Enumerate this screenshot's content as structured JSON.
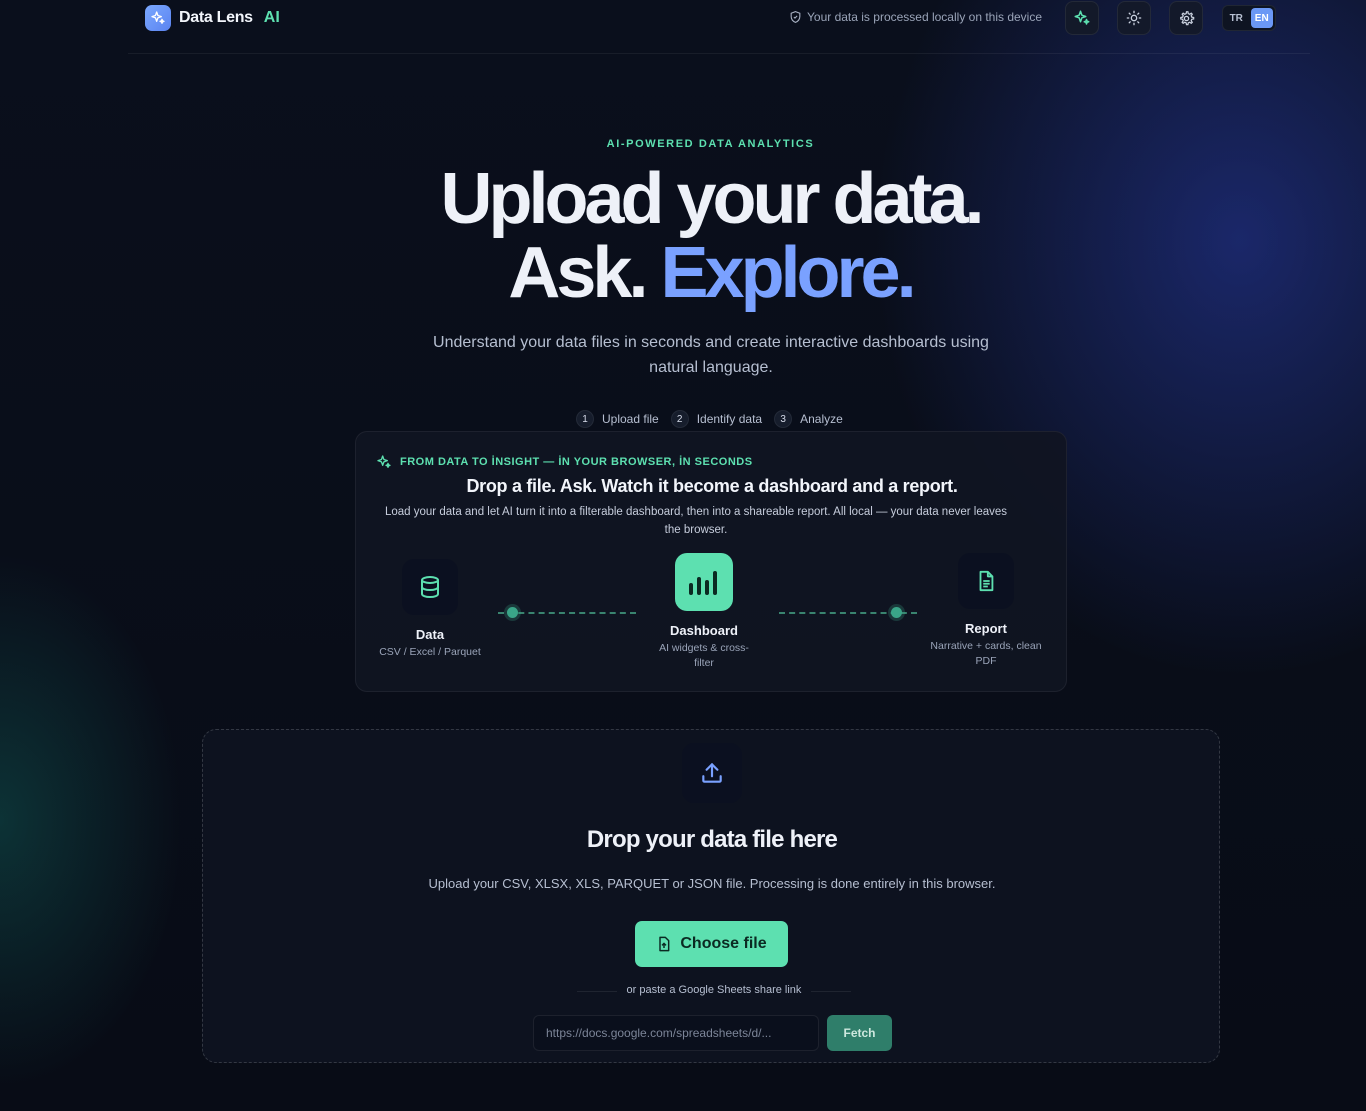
{
  "header": {
    "brand_name": "Data Lens",
    "brand_ai": "AI",
    "privacy_text": "Your data is processed locally on this device",
    "languages": {
      "tr": "TR",
      "en": "EN",
      "active": "EN"
    }
  },
  "hero": {
    "eyebrow": "AI-POWERED DATA ANALYTICS",
    "title_line1": "Upload your data.",
    "title_line2_plain": "Ask.",
    "title_line2_accent": "Explore.",
    "subtitle": "Understand your data files in seconds and create interactive dashboards using natural language."
  },
  "steps": [
    {
      "num": "1",
      "label": "Upload file"
    },
    {
      "num": "2",
      "label": "Identify data"
    },
    {
      "num": "3",
      "label": "Analyze"
    }
  ],
  "insight": {
    "tag": "FROM DATA TO İNSIGHT — İN YOUR BROWSER, İN SECONDS",
    "title": "Drop a file. Ask. Watch it become a dashboard and a report.",
    "description": "Load your data and let AI turn it into a filterable dashboard, then into a shareable report. All local — your data never leaves the browser.",
    "nodes": {
      "data": {
        "label": "Data",
        "sub": "CSV / Excel / Parquet"
      },
      "dashboard": {
        "label": "Dashboard",
        "sub": "AI widgets & cross-filter"
      },
      "report": {
        "label": "Report",
        "sub": "Narrative + cards, clean PDF"
      }
    }
  },
  "upload": {
    "title": "Drop your data file here",
    "description": "Upload your CSV, XLSX, XLS, PARQUET or JSON file. Processing is done entirely in this browser.",
    "choose_label": "Choose file",
    "or_text": "or paste a Google Sheets share link",
    "sheet_placeholder": "https://docs.google.com/spreadsheets/d/...",
    "fetch_label": "Fetch"
  },
  "colors": {
    "accent_green": "#5de0b0",
    "accent_blue": "#7aa1ff",
    "background": "#080c16"
  }
}
